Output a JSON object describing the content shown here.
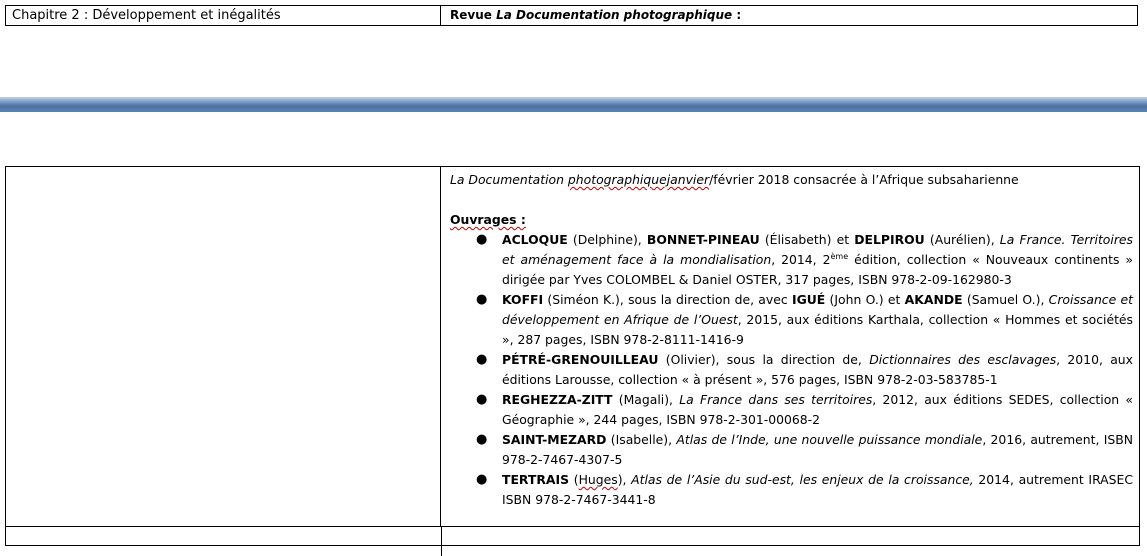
{
  "top_row": {
    "left": "Chapitre 2 : Développement et inégalités",
    "right_prefix": "Revue ",
    "right_title": "La Documentation photographique",
    "right_suffix": " :"
  },
  "main": {
    "intro_title": "La Documentation",
    "intro_word1": "photographiquejanvier",
    "intro_rest": "/février 2018 consacrée à l’Afrique subsaharienne",
    "ouvrages_label": "Ouvrages :",
    "books": [
      {
        "a1": "ACLOQUE",
        "a1n": " (Delphine), ",
        "a2": "BONNET-PINEAU",
        "a2n": " (Élisabeth) et ",
        "a3": "DELPIROU",
        "a3n": " (Aurélien), ",
        "title": "La France. Territoires et aménagement face à la mondialisation",
        "rest1": ", 2014, 2",
        "sup": "ème",
        "rest2": " édition, collection « Nouveaux continents » dirigée par Yves COLOMBEL & Daniel OSTER, 317 pages, ISBN 978-2-09-162980-3"
      },
      {
        "a1": "KOFFI",
        "a1n": " (Siméon K.), sous la direction de, avec ",
        "a2": "IGUÉ",
        "a2n": " (John O.) et ",
        "a3": "AKANDE",
        "a3n": " (Samuel O.), ",
        "title": "Croissance et développement en Afrique de l’Ouest",
        "rest": ", 2015, aux éditions Karthala, collection « Hommes et sociétés », 287 pages, ISBN 978-2-8111-1416-9"
      },
      {
        "a1": "PÉTRÉ-GRENOUILLEAU",
        "a1n": " (Olivier), sous la direction de, ",
        "title": "Dictionnaires des esclavages",
        "rest": ", 2010, aux éditions Larousse, collection « à présent », 576 pages, ISBN 978-2-03-583785-1"
      },
      {
        "a1": "REGHEZZA-ZITT",
        "a1n": " (Magali), ",
        "title": "La France dans ses territoires",
        "rest": ", 2012, aux éditions SEDES, collection « Géographie », 244 pages, ISBN 978-2-301-00068-2"
      },
      {
        "a1": "SAINT-MEZARD",
        "a1n": " (Isabelle), ",
        "title": "Atlas de l’Inde, une nouvelle puissance mondiale",
        "rest": ", 2016, autrement, ISBN 978-2-7467-4307-5"
      },
      {
        "a1": "TERTRAIS",
        "a1n_pre": " (",
        "a1n_sq": "Huges",
        "a1n_post": "), ",
        "title": "Atlas de l’Asie du sud-est, les enjeux de la croissance,",
        "rest": " 2014, autrement IRASEC ISBN 978-2-7467-3441-8"
      }
    ]
  }
}
